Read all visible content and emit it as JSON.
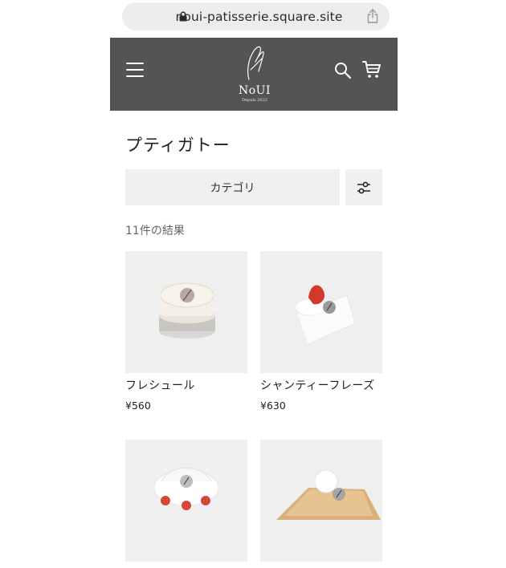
{
  "browser": {
    "url": "noui-patisserie.square.site"
  },
  "header": {
    "brand": "NoUI",
    "tagline": "Depuis 2022"
  },
  "page": {
    "title": "プティガトー",
    "category_label": "カテゴリ",
    "result_count": "11件の結果"
  },
  "products": [
    {
      "name": "フレシュール",
      "price": "¥560"
    },
    {
      "name": "シャンティーフレーズ",
      "price": "¥630"
    },
    {
      "name": "",
      "price": ""
    },
    {
      "name": "",
      "price": ""
    }
  ],
  "colors": {
    "header_bg": "#545454",
    "button_bg": "#f0f0f0"
  }
}
